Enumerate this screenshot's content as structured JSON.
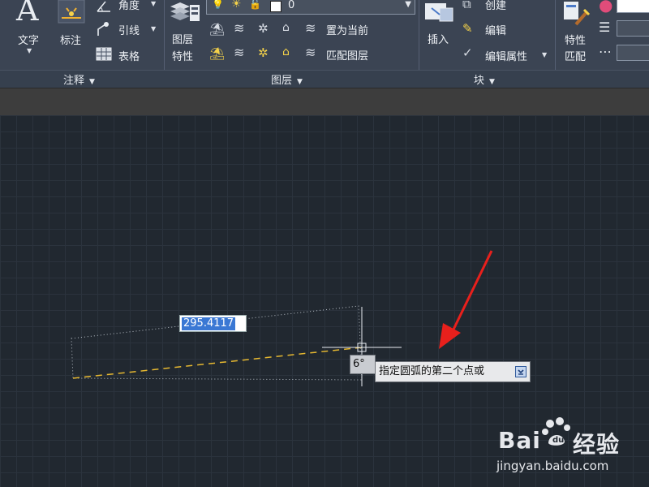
{
  "ribbon": {
    "annotation": {
      "title": "注释",
      "text_label": "文字",
      "dimension_label": "标注",
      "angle_label": "角度",
      "leader_label": "引线",
      "table_label": "表格"
    },
    "layers": {
      "title": "图层",
      "properties_label_1": "图层",
      "properties_label_2": "特性",
      "current_layer": "0",
      "set_current_label": "置为当前",
      "match_layer_label": "匹配图层"
    },
    "block": {
      "title": "块",
      "insert_label": "插入",
      "create_label": "创建",
      "edit_label": "编辑",
      "edit_attributes_label": "编辑属性"
    },
    "properties": {
      "match_label_1": "特性",
      "match_label_2": "匹配"
    }
  },
  "canvas": {
    "dynamic_input_value": "295.4117",
    "angle_value": "6°",
    "prompt_text": "指定圆弧的第二个点或"
  },
  "watermark": {
    "brand": "Bai",
    "brand_suffix": "经验",
    "url": "jingyan.baidu.com"
  },
  "colors": {
    "arrow": "#e8201c",
    "dashed_line": "#e6b830",
    "selection": "#3a78d4"
  }
}
